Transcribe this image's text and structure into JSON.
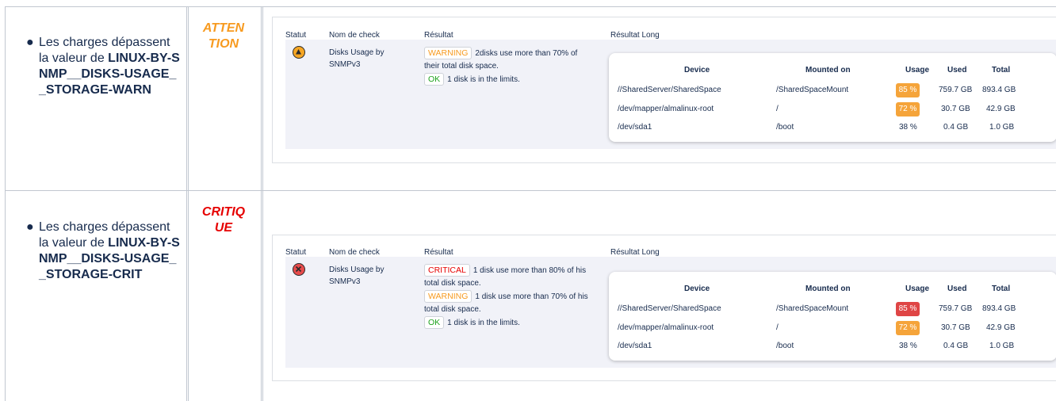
{
  "rows": [
    {
      "desc_prefix": "Les charges dépassent la valeur de ",
      "desc_bold": "LINUX-BY-SNMP__DISKS-USAGE__STORAGE-WARN",
      "severity_l1": "ATTEN",
      "severity_l2": "TION",
      "headers": {
        "status": "Statut",
        "check": "Nom de check",
        "result": "Résultat",
        "long": "Résultat Long"
      },
      "check_l1": "Disks Usage by",
      "check_l2": "SNMPv3",
      "results": [
        {
          "badge": "WARNING",
          "type": "w",
          "l1": "2disks use more than 70% of",
          "l2": "their total disk space."
        },
        {
          "badge": "OK",
          "type": "o",
          "l1": "1 disk is in the limits.",
          "l2": ""
        }
      ],
      "table": {
        "cols": [
          "Device",
          "Mounted on",
          "Usage",
          "Used",
          "Total"
        ],
        "rows": [
          {
            "device": "//SharedServer/SharedSpace",
            "mount": "/SharedSpaceMount",
            "usage": "85 %",
            "level": "warn",
            "used": "759.7 GB",
            "total": "893.4 GB"
          },
          {
            "device": "/dev/mapper/almalinux-root",
            "mount": "/",
            "usage": "72 %",
            "level": "warn",
            "used": "30.7 GB",
            "total": "42.9 GB"
          },
          {
            "device": "/dev/sda1",
            "mount": "/boot",
            "usage": "38 %",
            "level": "ok",
            "used": "0.4 GB",
            "total": "1.0 GB"
          }
        ]
      }
    },
    {
      "desc_prefix": "Les charges dépassent la valeur de ",
      "desc_bold": "LINUX-BY-SNMP__DISKS-USAGE__STORAGE-CRIT",
      "severity_l1": "CRITIQ",
      "severity_l2": "UE",
      "headers": {
        "status": "Statut",
        "check": "Nom de check",
        "result": "Résultat",
        "long": "Résultat Long"
      },
      "check_l1": "Disks Usage by",
      "check_l2": "SNMPv3",
      "results": [
        {
          "badge": "CRITICAL",
          "type": "c",
          "l1": "1 disk use more than 80% of his",
          "l2": "total disk space."
        },
        {
          "badge": "WARNING",
          "type": "w",
          "l1": "1 disk use more than 70% of his",
          "l2": "total disk space."
        },
        {
          "badge": "OK",
          "type": "o",
          "l1": "1 disk is in the limits.",
          "l2": ""
        }
      ],
      "table": {
        "cols": [
          "Device",
          "Mounted on",
          "Usage",
          "Used",
          "Total"
        ],
        "rows": [
          {
            "device": "//SharedServer/SharedSpace",
            "mount": "/SharedSpaceMount",
            "usage": "85 %",
            "level": "crit",
            "used": "759.7 GB",
            "total": "893.4 GB"
          },
          {
            "device": "/dev/mapper/almalinux-root",
            "mount": "/",
            "usage": "72 %",
            "level": "warn",
            "used": "30.7 GB",
            "total": "42.9 GB"
          },
          {
            "device": "/dev/sda1",
            "mount": "/boot",
            "usage": "38 %",
            "level": "ok",
            "used": "0.4 GB",
            "total": "1.0 GB"
          }
        ]
      }
    }
  ],
  "colors": {
    "warn": "#f5a43a",
    "crit": "#df4545",
    "ok": "#1fa31f"
  }
}
